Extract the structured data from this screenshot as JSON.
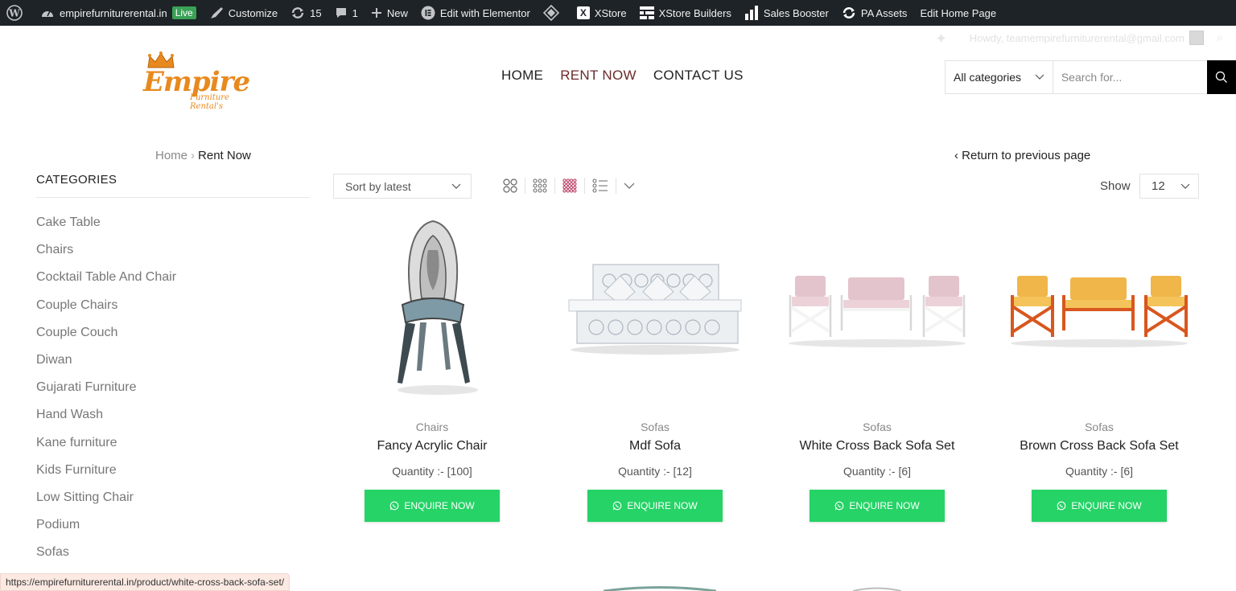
{
  "adminbar": {
    "site_name": "empirefurniturerental.in",
    "live_badge": "Live",
    "customize": "Customize",
    "updates_count": "15",
    "comments_count": "1",
    "new_label": "New",
    "elementor": "Edit with Elementor",
    "xstore": "XStore",
    "xstore_builders": "XStore Builders",
    "sales_booster": "Sales Booster",
    "pa_assets": "PA Assets",
    "edit_home": "Edit Home Page"
  },
  "header": {
    "howdy": "Howdy, teamempirefurniturerental@gmail.com",
    "logo": {
      "brand": "Empire",
      "tagline": "Furniture Rental's"
    },
    "nav": [
      "HOME",
      "RENT NOW",
      "CONTACT US"
    ],
    "search": {
      "category": "All categories",
      "placeholder": "Search for..."
    }
  },
  "breadcrumb": {
    "home": "Home",
    "sep": "›",
    "current": "Rent Now"
  },
  "return_link": "‹ Return to previous page",
  "sidebar": {
    "title": "CATEGORIES",
    "items": [
      "Cake Table",
      "Chairs",
      "Cocktail Table And Chair",
      "Couple Chairs",
      "Couple Couch",
      "Diwan",
      "Gujarati Furniture",
      "Hand Wash",
      "Kane furniture",
      "Kids Furniture",
      "Low Sitting Chair",
      "Podium",
      "Sofas"
    ]
  },
  "toolbar": {
    "sort": "Sort by latest",
    "show_label": "Show",
    "show_value": "12"
  },
  "products": [
    {
      "category": "Chairs",
      "name": "Fancy Acrylic Chair",
      "quantity": "Quantity :- [100]",
      "button": "ENQUIRE NOW"
    },
    {
      "category": "Sofas",
      "name": "Mdf Sofa",
      "quantity": "Quantity :- [12]",
      "button": "ENQUIRE NOW"
    },
    {
      "category": "Sofas",
      "name": "White Cross Back Sofa Set",
      "quantity": "Quantity :- [6]",
      "button": "ENQUIRE NOW"
    },
    {
      "category": "Sofas",
      "name": "Brown Cross Back Sofa Set",
      "quantity": "Quantity :- [6]",
      "button": "ENQUIRE NOW"
    }
  ],
  "status_url": "https://empirefurniturerental.in/product/white-cross-back-sofa-set/",
  "colors": {
    "admin_bar": "#1d2327",
    "accent_nav": "#6b2a2a",
    "enquire_green": "#25d366",
    "logo_orange": "#e8891e"
  }
}
